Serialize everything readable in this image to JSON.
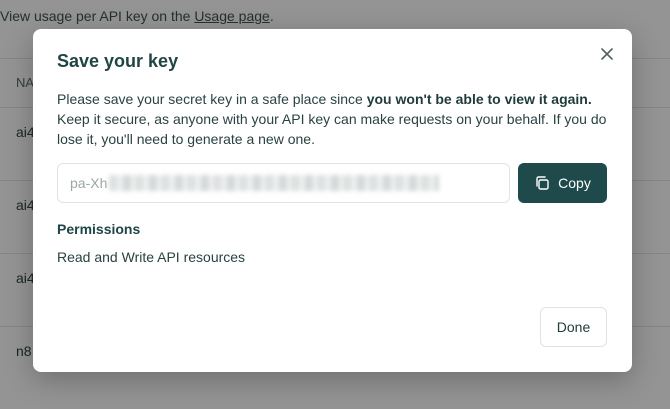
{
  "background": {
    "intro_text": "View usage per API key on the",
    "intro_link": "Usage page",
    "intro_suffix": ".",
    "table_header": "NA",
    "rows": [
      "ai4",
      "ai4",
      "ai4",
      "n8"
    ]
  },
  "modal": {
    "title": "Save your key",
    "close_icon": "close-icon",
    "description_part1": "Please save your secret key in a safe place since ",
    "description_bold": "you won't be able to view it again.",
    "description_part2": " Keep it secure, as anyone with your API key can make requests on your behalf. If you do lose it, you'll need to generate a new one.",
    "key_prefix": "pa-Xh",
    "copy_label": "Copy",
    "copy_icon": "copy-icon",
    "permissions_title": "Permissions",
    "permissions_value": "Read and Write API resources",
    "done_label": "Done"
  },
  "colors": {
    "accent": "#1f4a4b",
    "overlay": "rgba(0,0,0,0.42)"
  }
}
